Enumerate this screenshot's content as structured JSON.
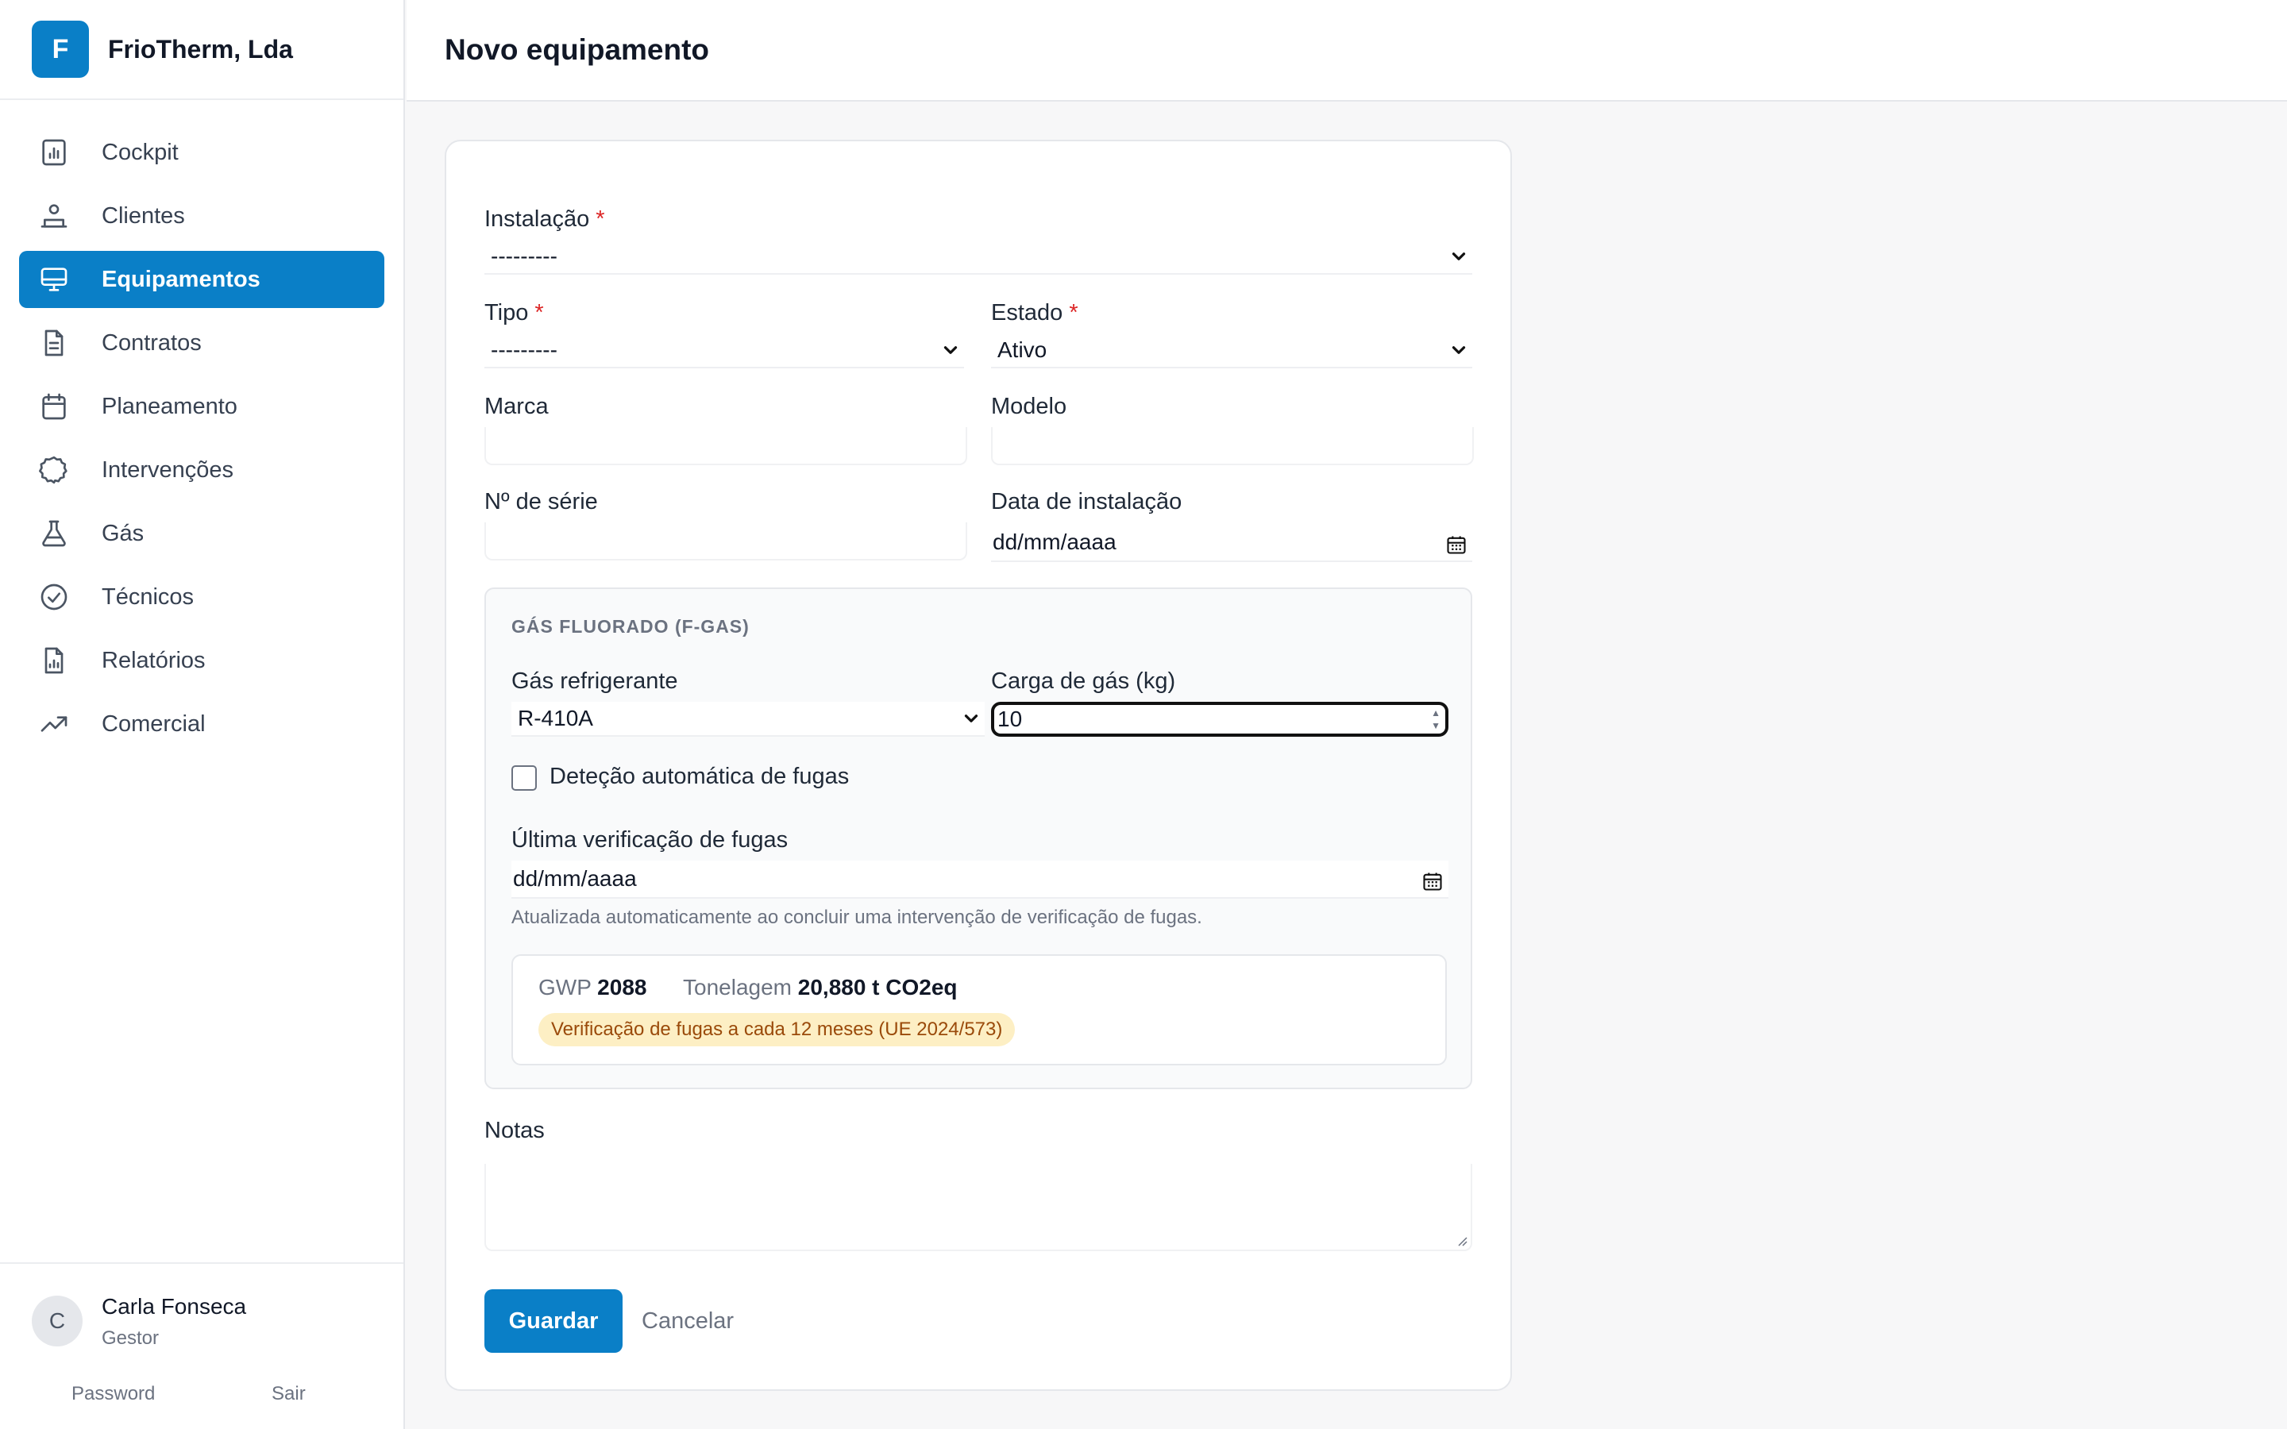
{
  "brand": {
    "initial": "F",
    "name": "FrioTherm, Lda"
  },
  "page": {
    "title": "Novo equipamento"
  },
  "nav": [
    {
      "label": "Cockpit",
      "icon": "chart-icon",
      "active": false
    },
    {
      "label": "Clientes",
      "icon": "users-icon",
      "active": false
    },
    {
      "label": "Equipamentos",
      "icon": "monitor-icon",
      "active": true
    },
    {
      "label": "Contratos",
      "icon": "document-icon",
      "active": false
    },
    {
      "label": "Planeamento",
      "icon": "calendar-icon",
      "active": false
    },
    {
      "label": "Intervenções",
      "icon": "cog-icon",
      "active": false
    },
    {
      "label": "Gás",
      "icon": "flask-icon",
      "active": false
    },
    {
      "label": "Técnicos",
      "icon": "check-circle-icon",
      "active": false
    },
    {
      "label": "Relatórios",
      "icon": "report-icon",
      "active": false
    },
    {
      "label": "Comercial",
      "icon": "trend-icon",
      "active": false
    }
  ],
  "user": {
    "initial": "C",
    "name": "Carla Fonseca",
    "role": "Gestor",
    "password_link": "Password",
    "logout_link": "Sair"
  },
  "form": {
    "instalacao": {
      "label": "Instalação",
      "required_mark": "*",
      "value": "---------"
    },
    "tipo": {
      "label": "Tipo",
      "required_mark": "*",
      "value": "---------"
    },
    "estado": {
      "label": "Estado",
      "required_mark": "*",
      "value": "Ativo"
    },
    "marca": {
      "label": "Marca",
      "value": ""
    },
    "modelo": {
      "label": "Modelo",
      "value": ""
    },
    "serie": {
      "label": "Nº de série",
      "value": ""
    },
    "data_instalacao": {
      "label": "Data de instalação",
      "placeholder": "dd/mm/aaaa"
    },
    "fgas": {
      "section_title": "GÁS FLUORADO (F-GAS)",
      "gas": {
        "label": "Gás refrigerante",
        "value": "R-410A"
      },
      "carga": {
        "label": "Carga de gás (kg)",
        "value": "10"
      },
      "detecao": {
        "label": "Deteção automática de fugas",
        "checked": false
      },
      "ultima": {
        "label": "Última verificação de fugas",
        "placeholder": "dd/mm/aaaa",
        "help": "Atualizada automaticamente ao concluir uma intervenção de verificação de fugas."
      },
      "info": {
        "gwp_label": "GWP",
        "gwp_value": "2088",
        "tonelagem_label": "Tonelagem",
        "tonelagem_value": "20,880 t CO2eq",
        "badge": "Verificação de fugas a cada 12 meses (UE 2024/573)"
      }
    },
    "notas": {
      "label": "Notas",
      "value": ""
    },
    "save_label": "Guardar",
    "cancel_label": "Cancelar"
  },
  "colors": {
    "accent": "#0a7fc7",
    "required": "#dc2626",
    "badge_bg": "#fdefc4",
    "badge_text": "#9a4a0a"
  }
}
